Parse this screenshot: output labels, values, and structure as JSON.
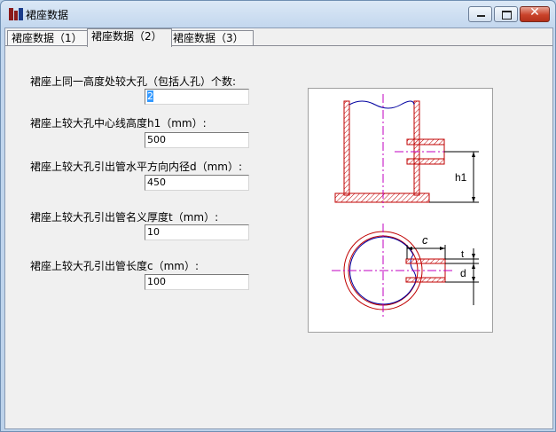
{
  "window": {
    "title": "裙座数据",
    "controls": {
      "minimize": "minimize",
      "maximize": "maximize",
      "close": "✕"
    }
  },
  "tabs": [
    {
      "label": "裙座数据（1）",
      "active": false
    },
    {
      "label": "裙座数据（2）",
      "active": true
    },
    {
      "label": "裙座数据（3）",
      "active": false
    }
  ],
  "form": {
    "hole_count": {
      "label": "裙座上同一高度处较大孔（包括人孔）个数:",
      "value": "2"
    },
    "center_height": {
      "label": "裙座上较大孔中心线高度h1（mm）:",
      "value": "500"
    },
    "pipe_inner_dia": {
      "label": "裙座上较大孔引出管水平方向内径d（mm）:",
      "value": "450"
    },
    "pipe_thickness": {
      "label": "裙座上较大孔引出管名义厚度t（mm）:",
      "value": "10"
    },
    "pipe_length": {
      "label": "裙座上较大孔引出管长度c（mm）:",
      "value": "100"
    }
  },
  "diagram": {
    "labels": {
      "h1": "h1",
      "c": "c",
      "t": "t",
      "d": "d"
    },
    "colors": {
      "section": "#c00000",
      "centerline": "#c000c0",
      "outline": "#0000a0",
      "dimension": "#000000"
    }
  }
}
